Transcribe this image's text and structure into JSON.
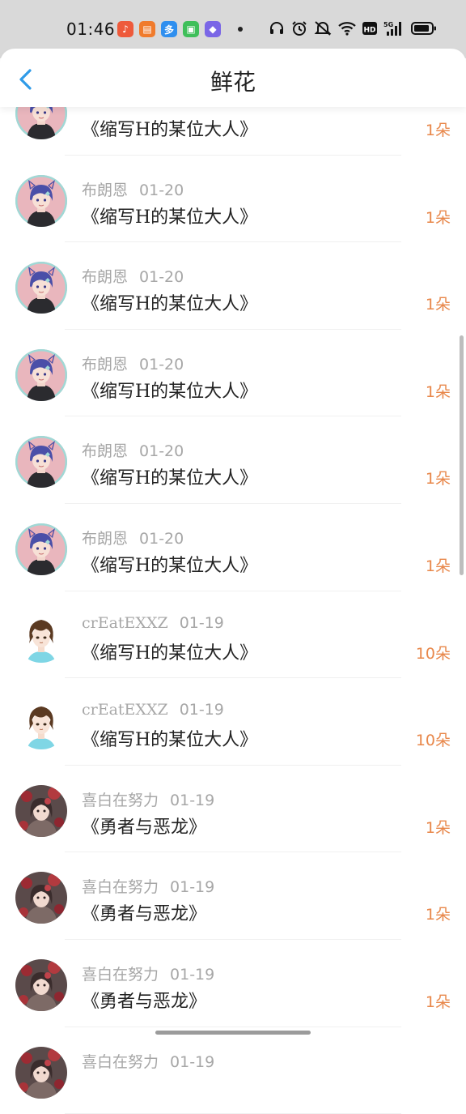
{
  "status_bar": {
    "time": "01:46",
    "app_icons": [
      {
        "name": "music-app-icon",
        "color": "#ee5a3b",
        "glyph": "♪"
      },
      {
        "name": "books-app-icon",
        "color": "#f07b2c",
        "glyph": "▤"
      },
      {
        "name": "photo-app-icon",
        "color": "#2f8fef",
        "glyph": "多"
      },
      {
        "name": "shopping-app-icon",
        "color": "#3fbf5a",
        "glyph": "▣"
      },
      {
        "name": "files-app-icon",
        "color": "#7a66e6",
        "glyph": "◆"
      }
    ],
    "icons": [
      "headphones-icon",
      "alarm-icon",
      "mute-icon",
      "wifi-icon",
      "hd-icon",
      "signal-5g-icon",
      "battery-icon"
    ],
    "hd_label": "HD",
    "network_label": "5G"
  },
  "header": {
    "title": "鲜花",
    "back_icon": "chevron-left-icon",
    "accent_color": "#2f9be8"
  },
  "list": {
    "items": [
      {
        "name": "",
        "date": "",
        "book": "《缩写H的某位大人》",
        "flowers": "1朵",
        "avatar": "anime-avatar-catgirl"
      },
      {
        "name": "布朗恩",
        "date": "01-20",
        "book": "《缩写H的某位大人》",
        "flowers": "1朵",
        "avatar": "anime-avatar-catgirl"
      },
      {
        "name": "布朗恩",
        "date": "01-20",
        "book": "《缩写H的某位大人》",
        "flowers": "1朵",
        "avatar": "anime-avatar-catgirl"
      },
      {
        "name": "布朗恩",
        "date": "01-20",
        "book": "《缩写H的某位大人》",
        "flowers": "1朵",
        "avatar": "anime-avatar-catgirl"
      },
      {
        "name": "布朗恩",
        "date": "01-20",
        "book": "《缩写H的某位大人》",
        "flowers": "1朵",
        "avatar": "anime-avatar-catgirl"
      },
      {
        "name": "布朗恩",
        "date": "01-20",
        "book": "《缩写H的某位大人》",
        "flowers": "1朵",
        "avatar": "anime-avatar-catgirl"
      },
      {
        "name": "crEatEXXZ",
        "date": "01-19",
        "book": "《缩写H的某位大人》",
        "flowers": "10朵",
        "avatar": "anime-avatar-brown-hair"
      },
      {
        "name": "crEatEXXZ",
        "date": "01-19",
        "book": "《缩写H的某位大人》",
        "flowers": "10朵",
        "avatar": "anime-avatar-brown-hair"
      },
      {
        "name": "喜白在努力",
        "date": "01-19",
        "book": "《勇者与恶龙》",
        "flowers": "1朵",
        "avatar": "anime-avatar-roses"
      },
      {
        "name": "喜白在努力",
        "date": "01-19",
        "book": "《勇者与恶龙》",
        "flowers": "1朵",
        "avatar": "anime-avatar-roses"
      },
      {
        "name": "喜白在努力",
        "date": "01-19",
        "book": "《勇者与恶龙》",
        "flowers": "1朵",
        "avatar": "anime-avatar-roses"
      },
      {
        "name": "喜白在努力",
        "date": "01-19",
        "book": "",
        "flowers": "",
        "avatar": "anime-avatar-roses"
      }
    ]
  },
  "colors": {
    "status_bar_bg": "#d9d9d9",
    "flower_count": "#e8874a",
    "meta_text": "#a7a7a7",
    "title_text": "#222222"
  }
}
